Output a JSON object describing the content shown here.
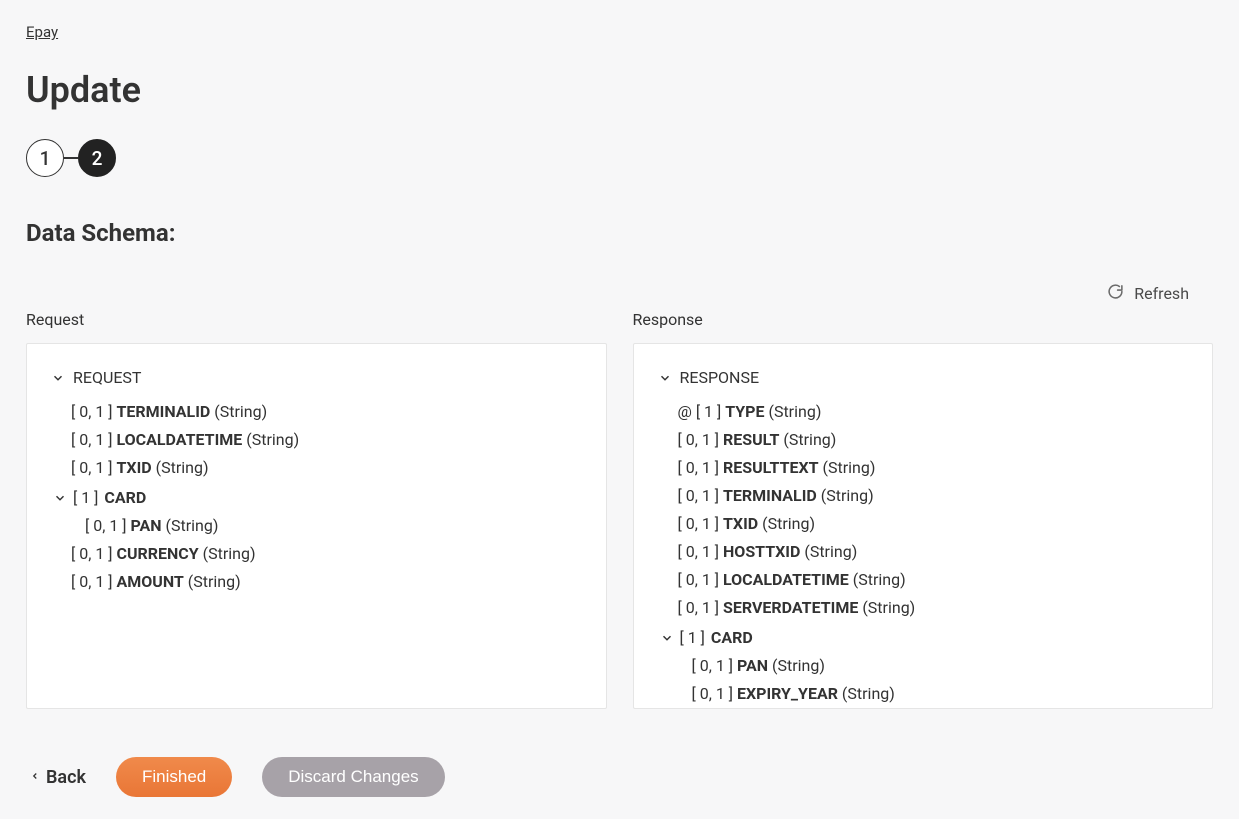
{
  "breadcrumb": "Epay",
  "page_title": "Update",
  "stepper": {
    "steps": [
      "1",
      "2"
    ],
    "active_index": 1
  },
  "section_title": "Data Schema:",
  "refresh_label": "Refresh",
  "columns": {
    "request_label": "Request",
    "response_label": "Response"
  },
  "request_tree": {
    "root": "REQUEST",
    "items": [
      {
        "occ": "[ 0, 1 ]",
        "name": "TERMINALID",
        "type": "(String)"
      },
      {
        "occ": "[ 0, 1 ]",
        "name": "LOCALDATETIME",
        "type": "(String)"
      },
      {
        "occ": "[ 0, 1 ]",
        "name": "TXID",
        "type": "(String)"
      }
    ],
    "card_node": {
      "occ": "[ 1 ]",
      "name": "CARD"
    },
    "card_children": [
      {
        "occ": "[ 0, 1 ]",
        "name": "PAN",
        "type": "(String)"
      }
    ],
    "tail": [
      {
        "occ": "[ 0, 1 ]",
        "name": "CURRENCY",
        "type": "(String)"
      },
      {
        "occ": "[ 0, 1 ]",
        "name": "AMOUNT",
        "type": "(String)"
      }
    ]
  },
  "response_tree": {
    "root": "RESPONSE",
    "type_item": {
      "prefix": "@",
      "occ": "[ 1 ]",
      "name": "TYPE",
      "type": "(String)"
    },
    "items": [
      {
        "occ": "[ 0, 1 ]",
        "name": "RESULT",
        "type": "(String)"
      },
      {
        "occ": "[ 0, 1 ]",
        "name": "RESULTTEXT",
        "type": "(String)"
      },
      {
        "occ": "[ 0, 1 ]",
        "name": "TERMINALID",
        "type": "(String)"
      },
      {
        "occ": "[ 0, 1 ]",
        "name": "TXID",
        "type": "(String)"
      },
      {
        "occ": "[ 0, 1 ]",
        "name": "HOSTTXID",
        "type": "(String)"
      },
      {
        "occ": "[ 0, 1 ]",
        "name": "LOCALDATETIME",
        "type": "(String)"
      },
      {
        "occ": "[ 0, 1 ]",
        "name": "SERVERDATETIME",
        "type": "(String)"
      }
    ],
    "card_node": {
      "occ": "[ 1 ]",
      "name": "CARD"
    },
    "card_children": [
      {
        "occ": "[ 0, 1 ]",
        "name": "PAN",
        "type": "(String)"
      },
      {
        "occ": "[ 0, 1 ]",
        "name": "EXPIRY_YEAR",
        "type": "(String)"
      }
    ]
  },
  "footer": {
    "back": "Back",
    "finished": "Finished",
    "discard": "Discard Changes"
  }
}
